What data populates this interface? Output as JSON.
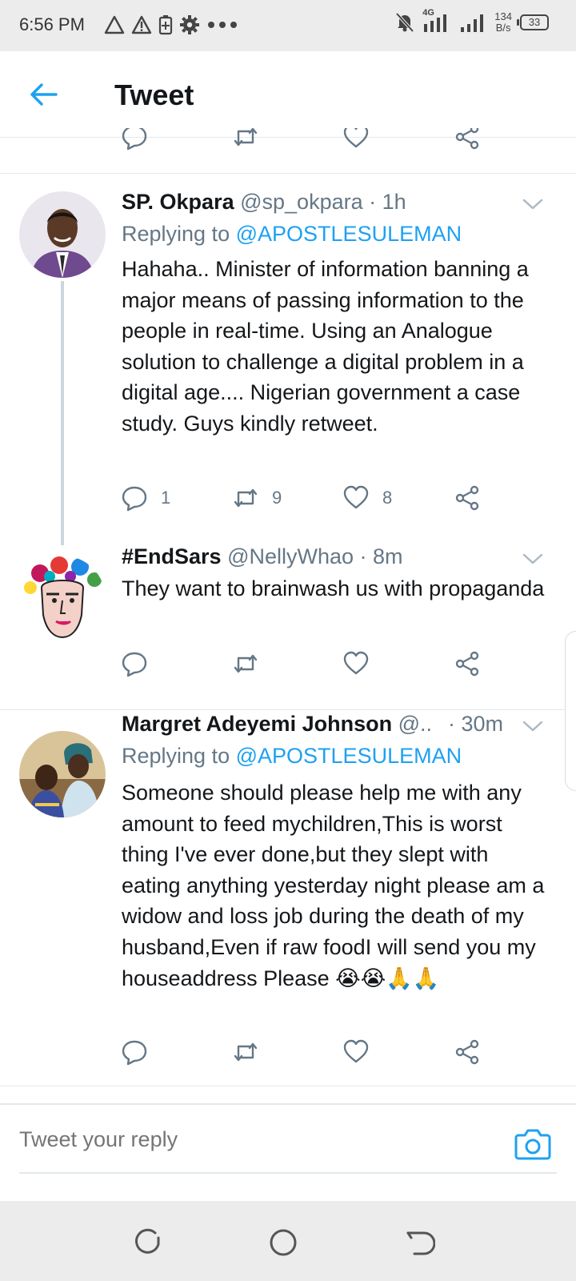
{
  "status_bar": {
    "time": "6:56 PM",
    "network_type": "4G",
    "speed_value": "134",
    "speed_unit": "B/s",
    "battery": "33",
    "left_icons": [
      "warning-icon",
      "warning-icon",
      "battery-saver-icon",
      "settings-icon",
      "more-icon"
    ],
    "right_icons": [
      "mute-icon",
      "signal-icon",
      "signal-icon"
    ]
  },
  "header": {
    "title": "Tweet",
    "back_icon": "arrow-left-icon"
  },
  "tweets": [
    {
      "name": "SP. Okpara",
      "handle": "@sp_okpara",
      "time": "· 1h",
      "replying_label": "Replying to",
      "replying_to": "@APOSTLESULEMAN",
      "text": "Hahaha..  Minister of information banning a major means of passing information to the people in real-time. Using an Analogue solution to challenge a digital problem in a digital age.... Nigerian government a case study. Guys kindly retweet.",
      "replies": "1",
      "retweets": "9",
      "likes": "8"
    },
    {
      "name": "#EndSars",
      "handle": "@NellyWhao",
      "time": "· 8m",
      "text": "They want to brainwash us with propaganda"
    },
    {
      "name": "Margret Adeyemi Johnson",
      "handle": "@...",
      "time": "· 30m",
      "replying_label": "Replying to",
      "replying_to": "@APOSTLESULEMAN",
      "text": "Someone should please help me with any amount to feed mychildren,This is worst thing I've ever done,but they slept with eating anything yesterday night please am a widow and loss job during the death of my husband,Even if raw foodI will send you my houseaddress Please 😭😭🙏🙏"
    }
  ],
  "reply_box": {
    "placeholder": "Tweet your reply",
    "camera_icon": "camera-icon"
  },
  "nav_bar": {
    "icons": [
      "recents-icon",
      "home-icon",
      "back-icon"
    ]
  },
  "colors": {
    "accent": "#1da1f2",
    "secondary_text": "#657786",
    "primary_text": "#14171a",
    "divider": "#e1e8ed",
    "system_bar": "#ececec"
  }
}
